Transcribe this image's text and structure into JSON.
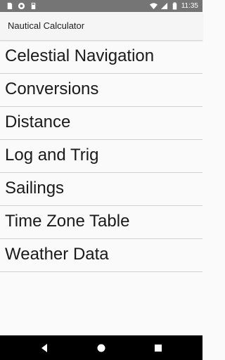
{
  "status_bar": {
    "time": "11:35",
    "left_icons": [
      "sim-card-icon",
      "sync-icon",
      "sd-card-icon"
    ],
    "right_icons": [
      "wifi-icon",
      "signal-icon",
      "battery-icon"
    ]
  },
  "app_bar": {
    "title": "Nautical Calculator"
  },
  "menu": {
    "items": [
      {
        "label": "Celestial Navigation"
      },
      {
        "label": "Conversions"
      },
      {
        "label": "Distance"
      },
      {
        "label": "Log and Trig"
      },
      {
        "label": "Sailings"
      },
      {
        "label": "Time Zone Table"
      },
      {
        "label": "Weather Data"
      }
    ]
  },
  "nav_bar": {
    "buttons": [
      "back-icon",
      "home-icon",
      "recents-icon"
    ]
  },
  "colors": {
    "status_bar": "#757575",
    "app_bar": "#f5f5f5",
    "background": "#fafafa",
    "divider": "#cfcfcf",
    "nav_bar": "#000000"
  }
}
